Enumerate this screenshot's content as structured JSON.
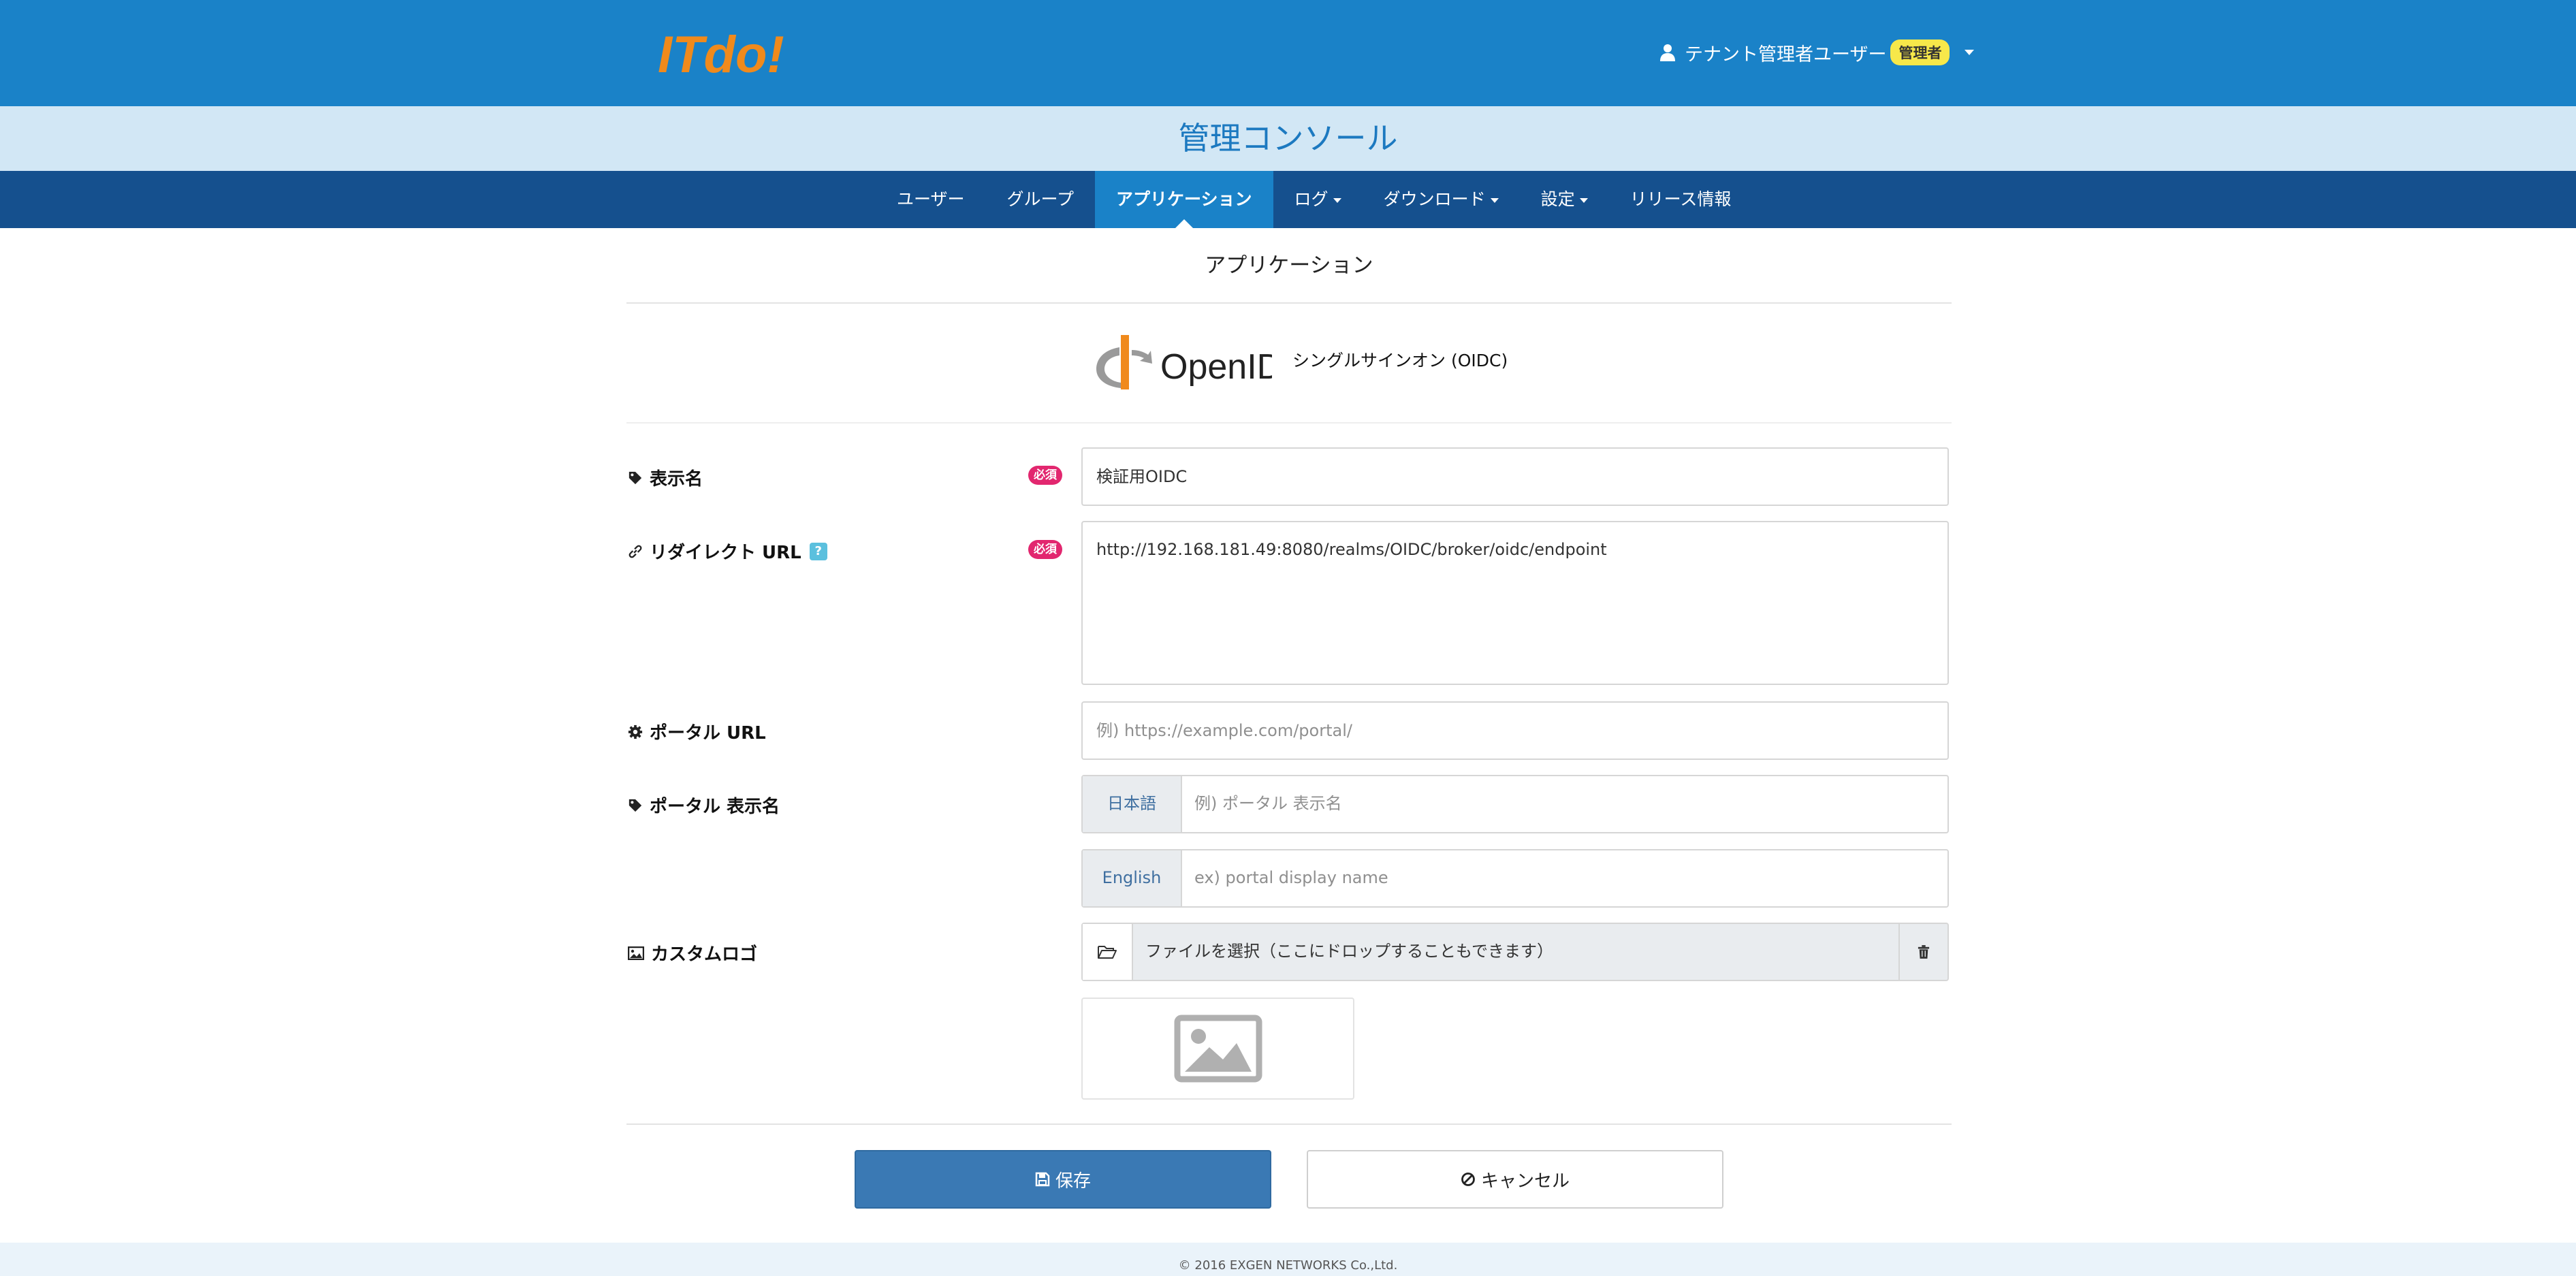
{
  "header": {
    "logo_text": "ITdo!",
    "user_name": "テナント管理者ユーザー",
    "user_role": "管理者"
  },
  "console": {
    "title": "管理コンソール"
  },
  "nav": {
    "items": [
      {
        "label": "ユーザー",
        "dropdown": false,
        "active": false
      },
      {
        "label": "グループ",
        "dropdown": false,
        "active": false
      },
      {
        "label": "アプリケーション",
        "dropdown": false,
        "active": true
      },
      {
        "label": "ログ",
        "dropdown": true,
        "active": false
      },
      {
        "label": "ダウンロード",
        "dropdown": true,
        "active": false
      },
      {
        "label": "設定",
        "dropdown": true,
        "active": false
      },
      {
        "label": "リリース情報",
        "dropdown": false,
        "active": false
      }
    ]
  },
  "page": {
    "heading": "アプリケーション",
    "app_logo_text": "OpenID",
    "app_type": "シングルサインオン (OIDC)"
  },
  "form": {
    "required_label": "必須",
    "display_name": {
      "label": "表示名",
      "value": "検証用OIDC"
    },
    "redirect_url": {
      "label": "リダイレクト URL",
      "help": "?",
      "value": "http://192.168.181.49:8080/realms/OIDC/broker/oidc/endpoint"
    },
    "portal_url": {
      "label": "ポータル URL",
      "placeholder": "例) https://example.com/portal/"
    },
    "portal_display_name": {
      "label": "ポータル 表示名",
      "ja_addon": "日本語",
      "ja_placeholder": "例) ポータル 表示名",
      "en_addon": "English",
      "en_placeholder": "ex) portal display name"
    },
    "custom_logo": {
      "label": "カスタムロゴ",
      "file_text": "ファイルを選択（ここにドロップすることもできます）"
    }
  },
  "buttons": {
    "save": "保存",
    "cancel": "キャンセル"
  },
  "footer": {
    "copyright": "© 2016 EXGEN NETWORKS Co.,Ltd."
  },
  "colors": {
    "header_bg": "#1a82c8",
    "nav_bg": "#15508e",
    "logo_orange": "#f08a1c",
    "required_badge": "#e2276f",
    "save_button": "#3a79b4"
  }
}
